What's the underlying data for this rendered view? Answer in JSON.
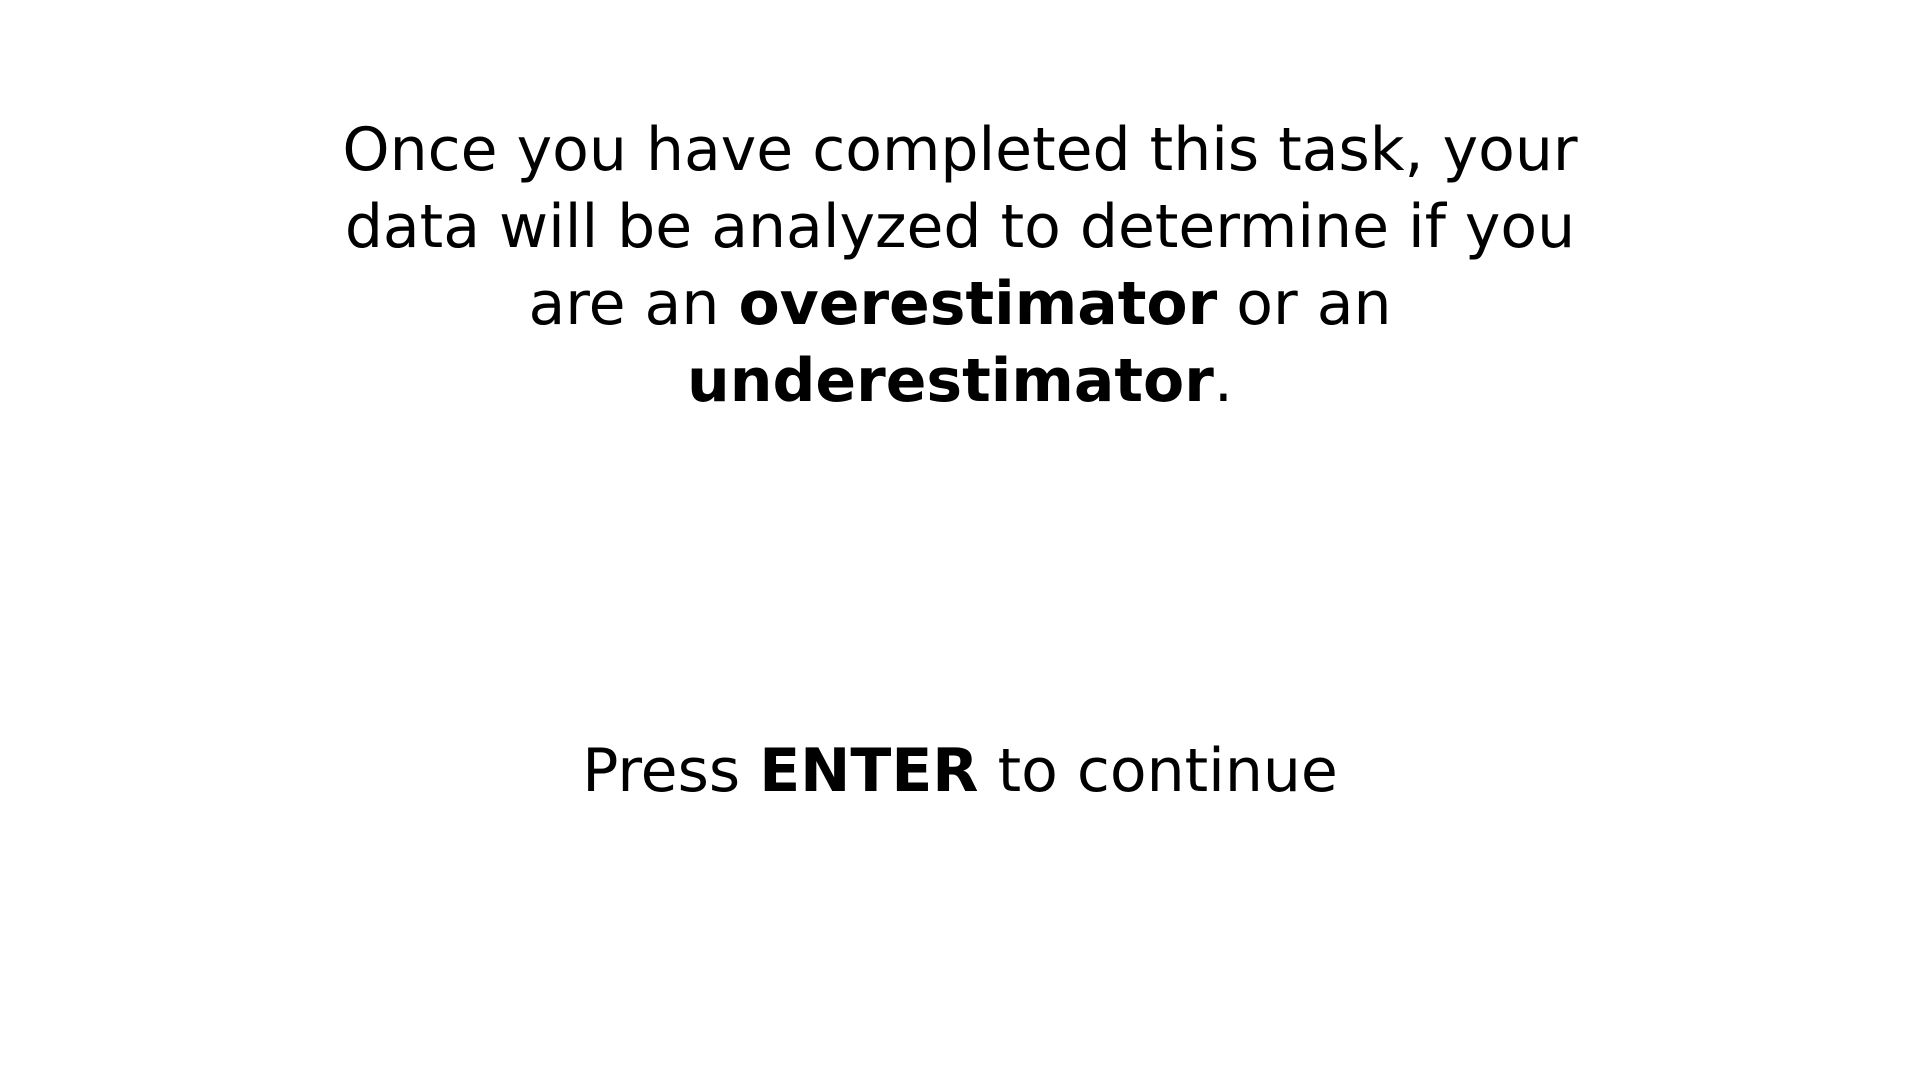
{
  "instruction": {
    "part1": "Once you have completed this task, your data will be analyzed to determine if you are an ",
    "term1": "overestimator",
    "part2": " or an ",
    "term2": "underestimator",
    "part3": "."
  },
  "prompt": {
    "prefix": "Press ",
    "key": "ENTER",
    "suffix": " to continue"
  },
  "colors": {
    "background": "#ffffff",
    "text": "#000000"
  }
}
